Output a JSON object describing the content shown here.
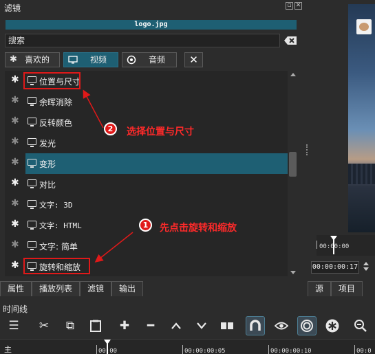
{
  "panel": {
    "title": "滤镜",
    "clip_name": "logo.jpg",
    "search_placeholder": "搜索",
    "tabs": [
      {
        "label": "喜欢的",
        "icon": "star-icon",
        "active": false
      },
      {
        "label": "视频",
        "icon": "monitor-icon",
        "active": true
      },
      {
        "label": "音频",
        "icon": "speaker-icon",
        "active": false
      }
    ]
  },
  "filters": [
    {
      "label": "位置与尺寸",
      "favorite": true,
      "selected": false
    },
    {
      "label": "余晖消除",
      "favorite": false,
      "selected": false
    },
    {
      "label": "反转颜色",
      "favorite": false,
      "selected": false
    },
    {
      "label": "发光",
      "favorite": false,
      "selected": false
    },
    {
      "label": "变形",
      "favorite": false,
      "selected": true
    },
    {
      "label": "对比",
      "favorite": true,
      "selected": false
    },
    {
      "label": "文字: 3D",
      "favorite": false,
      "selected": false
    },
    {
      "label": "文字: HTML",
      "favorite": true,
      "selected": false
    },
    {
      "label": "文字: 简单",
      "favorite": false,
      "selected": false
    },
    {
      "label": "旋转和缩放",
      "favorite": true,
      "selected": false
    }
  ],
  "annotations": {
    "step1_number": "1",
    "step1_text": "先点击旋转和缩放",
    "step2_number": "2",
    "step2_text": "选择位置与尺寸",
    "color": "#e01919"
  },
  "left_tabs": [
    "属性",
    "播放列表",
    "滤镜",
    "输出"
  ],
  "right_tabs": [
    "源",
    "项目"
  ],
  "player": {
    "ruler_label": "00:00:00",
    "timecode": "00:00:00:17"
  },
  "timeline": {
    "title": "时间线",
    "track_name": "主",
    "tick_labels": [
      "00:00",
      "00:00:00:05",
      "00:00:00:10",
      "00:0"
    ],
    "tools": [
      {
        "name": "menu-icon",
        "glyph": "☰"
      },
      {
        "name": "cut-icon",
        "glyph": "✂"
      },
      {
        "name": "copy-icon",
        "glyph": "⧉"
      },
      {
        "name": "paste-icon",
        "glyph": "📋"
      },
      {
        "name": "add-icon",
        "glyph": "✚"
      },
      {
        "name": "remove-icon",
        "glyph": "━"
      },
      {
        "name": "lift-icon",
        "glyph": "⌃"
      },
      {
        "name": "overwrite-icon",
        "glyph": "⌄"
      },
      {
        "name": "split-icon",
        "glyph": "▮"
      },
      {
        "name": "snap-icon",
        "glyph": "∩"
      },
      {
        "name": "scrub-icon",
        "glyph": "👁"
      },
      {
        "name": "ripple-icon",
        "glyph": "◎"
      },
      {
        "name": "ripple-all-icon",
        "glyph": "✲"
      },
      {
        "name": "zoom-out-icon",
        "glyph": "🔍"
      }
    ]
  }
}
